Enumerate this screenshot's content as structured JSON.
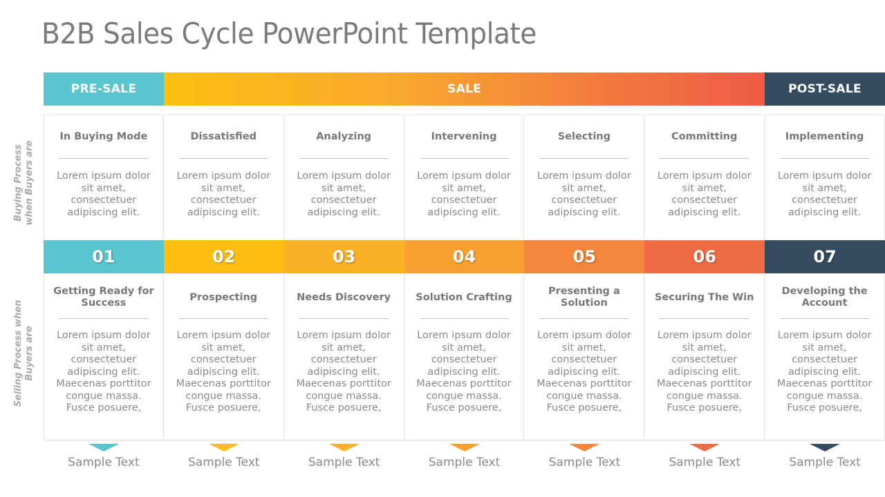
{
  "title": "B2B Sales Cycle PowerPoint Template",
  "phases": {
    "pre_sale": "PRE-SALE",
    "sale": "SALE",
    "post_sale": "POST-SALE"
  },
  "side_labels": {
    "buying": "Buying Process\nwhen Buyers are",
    "selling": "Selling Process when\nBuyers are"
  },
  "colors": {
    "pre_sale": "#5bc5cf",
    "sale_start": "#fdc010",
    "sale_end": "#ef5a47",
    "post_sale": "#344b60"
  },
  "steps": [
    {
      "number": "01",
      "color": "#5bc5cf",
      "buying_title": "In Buying Mode",
      "buying_body": "Lorem ipsum dolor sit amet, consectetuer adipiscing elit.",
      "selling_title": "Getting Ready for Success",
      "selling_body": "Lorem ipsum dolor sit amet, consectetuer adipiscing elit. Maecenas porttitor congue massa. Fusce posuere,",
      "sample": "Sample Text"
    },
    {
      "number": "02",
      "color": "#fdbd13",
      "buying_title": "Dissatisfied",
      "buying_body": "Lorem ipsum dolor sit amet, consectetuer adipiscing elit.",
      "selling_title": "Prospecting",
      "selling_body": "Lorem ipsum dolor sit amet, consectetuer adipiscing elit. Maecenas porttitor congue massa. Fusce posuere,",
      "sample": "Sample Text"
    },
    {
      "number": "03",
      "color": "#fbb126",
      "buying_title": "Analyzing",
      "buying_body": "Lorem ipsum dolor sit amet, consectetuer adipiscing elit.",
      "selling_title": "Needs Discovery",
      "selling_body": "Lorem ipsum dolor sit amet, consectetuer adipiscing elit. Maecenas porttitor congue massa. Fusce posuere,",
      "sample": "Sample Text"
    },
    {
      "number": "04",
      "color": "#f8a030",
      "buying_title": "Intervening",
      "buying_body": "Lorem ipsum dolor sit amet, consectetuer adipiscing elit.",
      "selling_title": "Solution Crafting",
      "selling_body": "Lorem ipsum dolor sit amet, consectetuer adipiscing elit. Maecenas porttitor congue massa. Fusce posuere,",
      "sample": "Sample Text"
    },
    {
      "number": "05",
      "color": "#f4873d",
      "buying_title": "Selecting",
      "buying_body": "Lorem ipsum dolor sit amet, consectetuer adipiscing elit.",
      "selling_title": "Presenting a Solution",
      "selling_body": "Lorem ipsum dolor sit amet, consectetuer adipiscing elit. Maecenas porttitor congue massa. Fusce posuere,",
      "sample": "Sample Text"
    },
    {
      "number": "06",
      "color": "#ef6b45",
      "buying_title": "Committing",
      "buying_body": "Lorem ipsum dolor sit amet, consectetuer adipiscing elit.",
      "selling_title": "Securing The Win",
      "selling_body": "Lorem ipsum dolor sit amet, consectetuer adipiscing elit. Maecenas porttitor congue massa. Fusce posuere,",
      "sample": "Sample Text"
    },
    {
      "number": "07",
      "color": "#344b60",
      "buying_title": "Implementing",
      "buying_body": "Lorem ipsum dolor sit amet, consectetuer adipiscing elit.",
      "selling_title": "Developing the Account",
      "selling_body": "Lorem ipsum dolor sit amet, consectetuer adipiscing elit. Maecenas porttitor congue massa. Fusce posuere,",
      "sample": "Sample Text"
    }
  ]
}
